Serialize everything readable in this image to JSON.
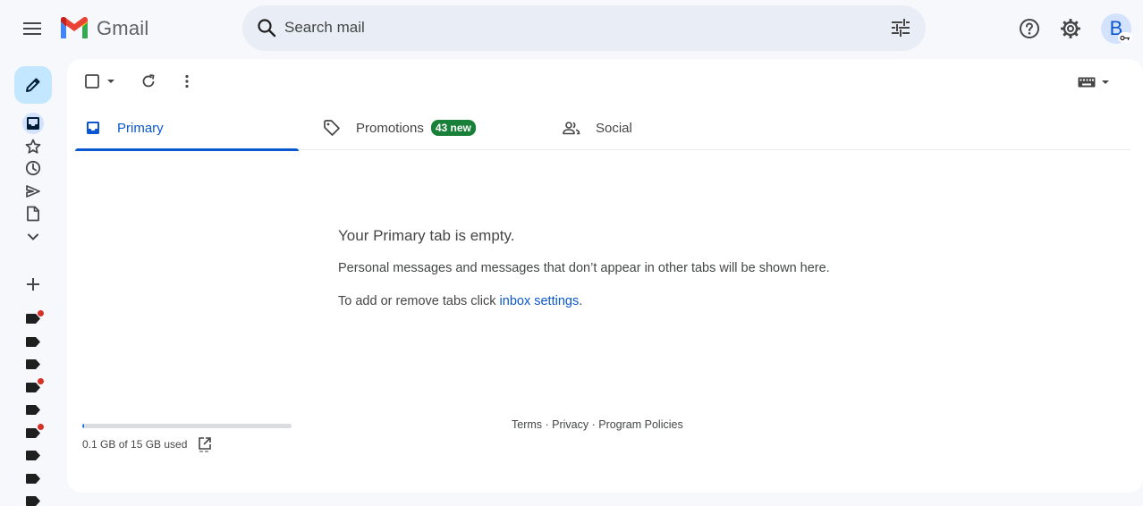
{
  "app": {
    "logo_text": "Gmail"
  },
  "search": {
    "placeholder": "Search mail"
  },
  "account": {
    "avatar_letter": "B"
  },
  "tabs": [
    {
      "label": "Primary",
      "active": true
    },
    {
      "label": "Promotions",
      "badge": "43 new"
    },
    {
      "label": "Social"
    }
  ],
  "empty_state": {
    "title": "Your Primary tab is empty.",
    "description": "Personal messages and messages that don’t appear in other tabs will be shown here.",
    "settings_prefix": "To add or remove tabs click ",
    "settings_link": "inbox settings",
    "settings_suffix": "."
  },
  "storage": {
    "text": "0.1 GB of 15 GB used",
    "used_fraction": 0.0067
  },
  "footer": {
    "terms": "Terms",
    "sep1": " · ",
    "privacy": "Privacy",
    "sep2": " · ",
    "policies": "Program Policies"
  },
  "colors": {
    "accent": "#0b57d0",
    "compose_bg": "#c2e7ff",
    "badge_green": "#188038",
    "label_dot": "#d93025"
  },
  "icons": {
    "menu": "menu-icon",
    "search": "search-icon",
    "tune": "tune-icon",
    "help": "help-icon",
    "settings": "gear-icon",
    "compose": "pencil-icon",
    "inbox": "inbox-icon",
    "starred": "star-icon",
    "snoozed": "clock-icon",
    "sent": "send-icon",
    "drafts": "draft-icon",
    "more": "chevron-down-icon",
    "create_label": "plus-icon",
    "label": "label-icon"
  }
}
